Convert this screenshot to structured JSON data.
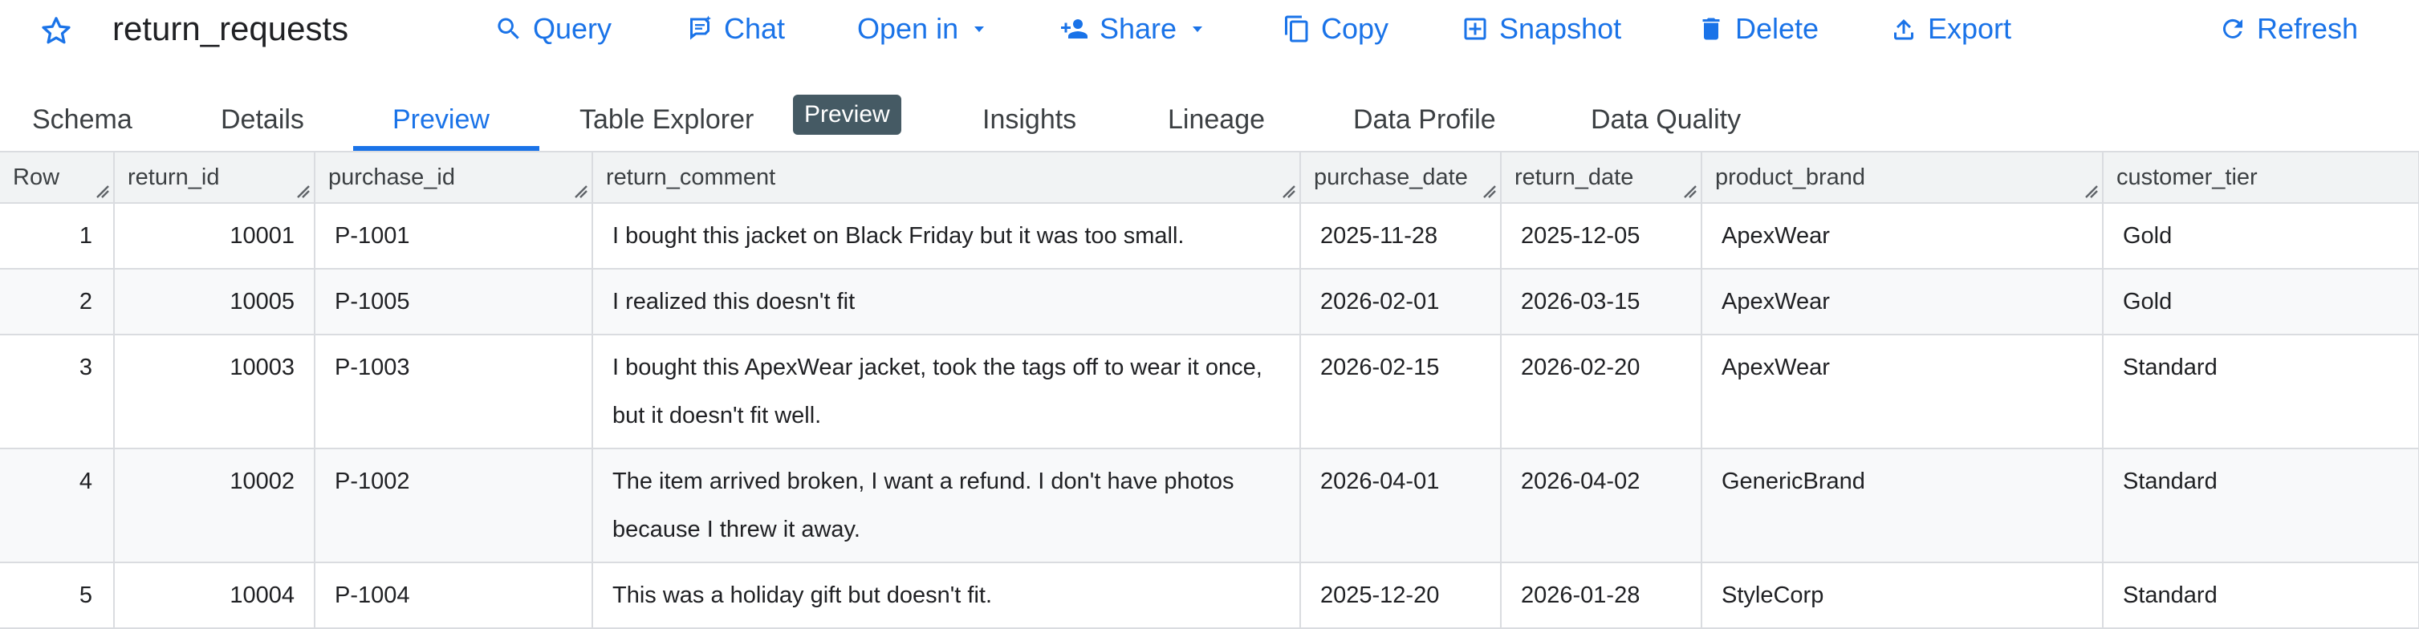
{
  "header": {
    "title": "return_requests",
    "actions": {
      "query": "Query",
      "chat": "Chat",
      "open_in": "Open in",
      "share": "Share",
      "copy": "Copy",
      "snapshot": "Snapshot",
      "delete": "Delete",
      "export": "Export",
      "refresh": "Refresh"
    }
  },
  "tabs": {
    "schema": "Schema",
    "details": "Details",
    "preview": "Preview",
    "table_explorer": "Table Explorer",
    "table_explorer_badge": "Preview",
    "insights": "Insights",
    "lineage": "Lineage",
    "data_profile": "Data Profile",
    "data_quality": "Data Quality"
  },
  "table": {
    "columns": [
      "Row",
      "return_id",
      "purchase_id",
      "return_comment",
      "purchase_date",
      "return_date",
      "product_brand",
      "customer_tier"
    ],
    "rows": [
      [
        "1",
        "10001",
        "P-1001",
        "I bought this jacket on Black Friday but it was too small.",
        "2025-11-28",
        "2025-12-05",
        "ApexWear",
        "Gold"
      ],
      [
        "2",
        "10005",
        "P-1005",
        "I realized this doesn't fit",
        "2026-02-01",
        "2026-03-15",
        "ApexWear",
        "Gold"
      ],
      [
        "3",
        "10003",
        "P-1003",
        "I bought this ApexWear jacket, took the tags off to wear it once, but it doesn't fit well.",
        "2026-02-15",
        "2026-02-20",
        "ApexWear",
        "Standard"
      ],
      [
        "4",
        "10002",
        "P-1002",
        "The item arrived broken, I want a refund. I don't have photos because I threw it away.",
        "2026-04-01",
        "2026-04-02",
        "GenericBrand",
        "Standard"
      ],
      [
        "5",
        "10004",
        "P-1004",
        "This was a holiday gift but doesn't fit.",
        "2025-12-20",
        "2026-01-28",
        "StyleCorp",
        "Standard"
      ]
    ]
  },
  "colors": {
    "accent": "#1a73e8",
    "badge": "#455a64",
    "header_bg": "#f1f3f4",
    "alt_row_bg": "#f8f9fa"
  }
}
